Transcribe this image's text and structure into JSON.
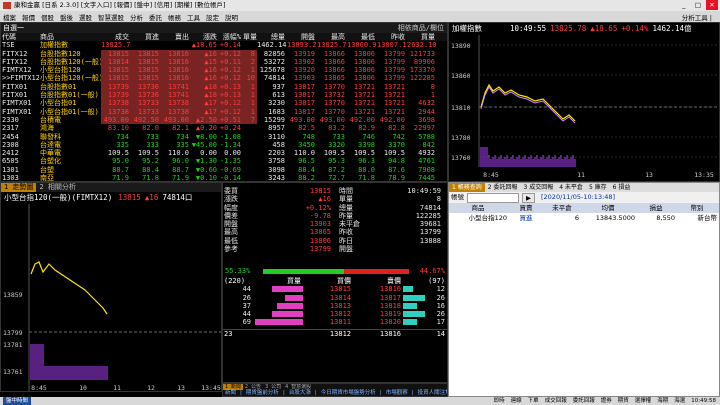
{
  "window": {
    "title": "康和金贏 [日系 2.3.0] [文字入口] [報價] [盤中] [信用] [期權] [數位帳戶]",
    "menu": [
      "檔案",
      "報價",
      "個股",
      "盤後",
      "選股",
      "智慧選股",
      "分析",
      "委託",
      "帳務",
      "工具",
      "設定",
      "說明"
    ],
    "tools": "分析工具 |"
  },
  "quote_table": {
    "title": "自選一",
    "right_label": "相依商品/欄位",
    "headers": [
      "代碼",
      "商品",
      "成交",
      "買進",
      "賣出",
      "漲跌",
      "漲幅%",
      "單量",
      "總量",
      "開盤",
      "最高",
      "最低",
      "昨收",
      "買量"
    ],
    "rows": [
      {
        "cls": "up",
        "cells": [
          "TSE",
          "加權指數",
          "13825.78",
          "",
          "",
          "▲18.65",
          "+0.14",
          "",
          "1462.14",
          "13893.20",
          "13825.78",
          "13860.95",
          "13807.13",
          "2632.10"
        ]
      },
      {
        "cls": "up",
        "hl": true,
        "cells": [
          "FITX12",
          "台股指數120",
          "13815",
          "13815",
          "13816",
          "▲16",
          "+0.12",
          "8",
          "82856",
          "13919",
          "13866",
          "13806",
          "13799",
          "121733"
        ]
      },
      {
        "cls": "up",
        "hl": true,
        "cells": [
          "FITX12",
          "台股指數120(一般)",
          "13814",
          "13815",
          "13816",
          "▲15",
          "+0.11",
          "2",
          "53272",
          "13902",
          "13866",
          "13806",
          "13799",
          "89906"
        ]
      },
      {
        "cls": "up",
        "hl": true,
        "cells": [
          "FIMTX12",
          "小型台指120",
          "13815",
          "13815",
          "13816",
          "▲16",
          "+0.12",
          "1",
          "125678",
          "13920",
          "13866",
          "13806",
          "13799",
          "173370"
        ]
      },
      {
        "cls": "up",
        "hl": true,
        "cells": [
          ">>FIMTX12",
          "小型台指120(一般)",
          "13815",
          "13815",
          "13816",
          "▲16",
          "+0.12",
          "10",
          "74814",
          "13903",
          "13865",
          "13806",
          "13799",
          "122285"
        ]
      },
      {
        "cls": "up",
        "hl": true,
        "cells": [
          "FITX01",
          "台股指數01",
          "13739",
          "13736",
          "13741",
          "▲18",
          "+0.13",
          "1",
          "937",
          "13817",
          "13770",
          "13721",
          "13721",
          "8"
        ]
      },
      {
        "cls": "up",
        "hl": true,
        "cells": [
          "FITX01",
          "台股指數01(一般)",
          "13739",
          "13736",
          "13741",
          "▲18",
          "+0.13",
          "1",
          "613",
          "13817",
          "13732",
          "13721",
          "13721",
          "1"
        ]
      },
      {
        "cls": "up",
        "hl": true,
        "cells": [
          "FIMTX01",
          "小型台指01",
          "13738",
          "13733",
          "13738",
          "▲17",
          "+0.12",
          "1",
          "3230",
          "13817",
          "13770",
          "13721",
          "13721",
          "4632"
        ]
      },
      {
        "cls": "up",
        "hl": true,
        "cells": [
          "FIMTX01",
          "小型台指01(一般)",
          "13738",
          "13733",
          "13738",
          "▲17",
          "+0.12",
          "1",
          "1683",
          "13817",
          "13770",
          "13721",
          "13721",
          "2944"
        ]
      },
      {
        "cls": "up",
        "hl": true,
        "cells": [
          "2330",
          "台積電",
          "493.00",
          "492.50",
          "493.00",
          "▲2.50",
          "+0.51",
          "7",
          "15299",
          "493.00",
          "493.00",
          "492.00",
          "492.00",
          "3698"
        ]
      },
      {
        "cls": "up",
        "cells": [
          "2317",
          "鴻海",
          "83.10",
          "82.0",
          "82.1",
          "▲0.20",
          "+0.24",
          "",
          "8957",
          "82.5",
          "83.2",
          "82.9",
          "82.8",
          "22997"
        ]
      },
      {
        "cls": "dn",
        "cells": [
          "2454",
          "聯發科",
          "734",
          "733",
          "734",
          "▼8.00",
          "-1.08",
          "",
          "3110",
          "748",
          "733",
          "746",
          "742",
          "5788"
        ]
      },
      {
        "cls": "dn",
        "cells": [
          "2308",
          "台達電",
          "335",
          "333",
          "335",
          "▼45.00",
          "-1.34",
          "",
          "458",
          "3450",
          "3320",
          "3398",
          "3370",
          "842"
        ]
      },
      {
        "cls": "wt",
        "cells": [
          "2412",
          "中華電",
          "109.5",
          "109.5",
          "110.0",
          "0.00",
          "0.00",
          "",
          "2203",
          "110.0",
          "109.5",
          "109.5",
          "109.5",
          "4932"
        ]
      },
      {
        "cls": "dn",
        "cells": [
          "6505",
          "台塑化",
          "95.0",
          "95.2",
          "96.0",
          "▼1.30",
          "-1.35",
          "",
          "3758",
          "96.5",
          "95.3",
          "96.3",
          "94.8",
          "4761"
        ]
      },
      {
        "cls": "dn",
        "cells": [
          "1301",
          "台塑",
          "88.7",
          "88.4",
          "88.7",
          "▼0.60",
          "-0.69",
          "",
          "3098",
          "88.4",
          "87.2",
          "88.0",
          "87.6",
          "7908"
        ]
      },
      {
        "cls": "dn",
        "cells": [
          "1303",
          "南亞",
          "71.9",
          "71.8",
          "71.9",
          "▼0.10",
          "-0.14",
          "",
          "3243",
          "88.2",
          "72.7",
          "71.8",
          "78.9",
          "7445"
        ]
      },
      {
        "cls": "up",
        "cells": [
          "2002",
          "中鋼",
          "66.20",
          "66.2",
          "66.1",
          "▲0.40",
          "+0.61",
          "",
          "20250",
          "66.2",
          "65.9",
          "65.6",
          "65.6",
          "4415"
        ]
      },
      {
        "cls": "up",
        "cells": [
          "2881",
          "富邦金",
          "41.70",
          "41.65",
          "41.70",
          "▲0.25",
          "+0.60",
          "",
          "8256",
          "41.80",
          "41.75",
          "41.75",
          "41.75",
          "11002"
        ]
      }
    ]
  },
  "index_chart": {
    "title": "加權指數",
    "time": "10:49:55",
    "price": "13825.78",
    "change": "▲18.65",
    "pct": "+0.14%",
    "volume": "1462.14億",
    "y_ticks": [
      "13890",
      "13860",
      "13810",
      "13780",
      "13760"
    ],
    "x_ticks": [
      "8:45",
      "11",
      "13",
      "13:35"
    ]
  },
  "futures_chart": {
    "tab_label": "1 走勢圖",
    "tab2": "2 相關分析",
    "title": "小型台指120(一般)(FIMTX12)",
    "price": "13815",
    "change": "▲16",
    "volume": "74814口",
    "y_ticks": [
      "13859",
      "13799",
      "13781",
      "13761"
    ],
    "x_ticks": [
      "8:45",
      "10",
      "11",
      "12",
      "13",
      "13:45"
    ]
  },
  "detail": {
    "left": [
      {
        "k": "委買",
        "v": "13815"
      },
      {
        "k": "漲跌",
        "v": "▲16"
      },
      {
        "k": "幅度",
        "v": "+0.12%"
      },
      {
        "k": "價差",
        "v": "-9.78"
      },
      {
        "k": "開盤",
        "v": "13903"
      },
      {
        "k": "最高",
        "v": "13865"
      },
      {
        "k": "最低",
        "v": "13806"
      },
      {
        "k": "參考",
        "v": "13799"
      }
    ],
    "right": [
      {
        "k": "時間",
        "v": "10:49:59"
      },
      {
        "k": "單量",
        "v": "8"
      },
      {
        "k": "總量",
        "v": "74814"
      },
      {
        "k": "昨量",
        "v": "122285"
      },
      {
        "k": "未平倉",
        "v": "39681"
      },
      {
        "k": "昨收",
        "v": "13799"
      },
      {
        "k": "昨日",
        "v": "13888"
      },
      {
        "k": "開盤",
        "v": ""
      }
    ],
    "buy_ratio": "55.33%",
    "sell_ratio": "44.67%",
    "buy_total": "(220)",
    "sell_total": "(97)",
    "book_headers": [
      "買量",
      "買價",
      "賣價",
      "賣量"
    ],
    "book": [
      [
        "44",
        "13815",
        "13816",
        "12"
      ],
      [
        "26",
        "13814",
        "13817",
        "26"
      ],
      [
        "37",
        "13813",
        "13818",
        "16"
      ],
      [
        "44",
        "13812",
        "13819",
        "26"
      ],
      [
        "69",
        "13811",
        "13820",
        "17"
      ]
    ],
    "book_buy_pct": [
      0.64,
      0.38,
      0.54,
      0.64,
      1.0
    ],
    "book_sell_pct": [
      0.46,
      1.0,
      0.62,
      1.0,
      0.65
    ],
    "footer": [
      "23",
      "13812",
      "13816",
      "14"
    ]
  },
  "news": {
    "tabs": [
      "1 新聞",
      "2 公告",
      "3 公司",
      "4 智慧選股"
    ],
    "text": "新聞 | 期貨盤前分析 | 台股大漲 | 今日期貨市場盤勢分析 | 市場觀察 | 投資人關注焦點"
  },
  "orders": {
    "tabs": [
      "1 帳務查詢",
      "2 委託回報",
      "3 成交回報",
      "4 未平倉",
      "5 庫存",
      "6 損益"
    ],
    "filter_label": "帳號",
    "date": "[2020/11/05-10:13:48]",
    "headers": [
      "商品",
      "買賣",
      "未平倉",
      "均價",
      "損益",
      "幣別"
    ],
    "row": [
      "小型台指120",
      "買進",
      "6",
      "13843.5000",
      "8,550",
      "新台幣"
    ]
  },
  "status": {
    "left": "盤中時間",
    "items": [
      "即時",
      "連線",
      "下單",
      "成交回報",
      "委託回報",
      "證券",
      "期貨",
      "選擇權",
      "海期",
      "海選"
    ],
    "clock": "10:49:58"
  }
}
